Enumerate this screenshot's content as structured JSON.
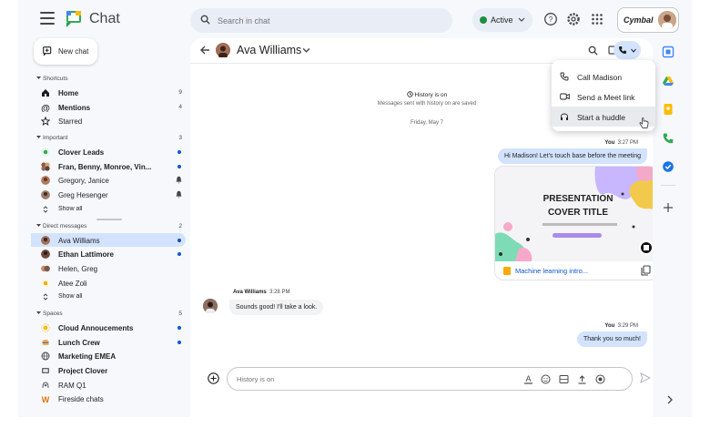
{
  "app": {
    "title": "Chat"
  },
  "search": {
    "placeholder": "Search in chat"
  },
  "status": {
    "label": "Active",
    "color": "#1e8e3e"
  },
  "account": {
    "org": "Cymbal"
  },
  "new_chat": {
    "label": "New chat"
  },
  "nav": {
    "shortcuts": {
      "title": "Shortcuts",
      "items": [
        {
          "label": "Home",
          "count": "9",
          "icon": "home-icon"
        },
        {
          "label": "Mentions",
          "count": "4",
          "icon": "at-icon"
        },
        {
          "label": "Starred",
          "icon": "star-icon"
        }
      ]
    },
    "important": {
      "title": "Important",
      "count": "3",
      "items": [
        {
          "label": "Clover Leads"
        },
        {
          "label": "Fran, Benny, Monroe, Vin..."
        },
        {
          "label": "Gregory, Janice"
        },
        {
          "label": "Greg Hesenger"
        },
        {
          "label": "Show all"
        }
      ]
    },
    "direct": {
      "title": "Direct messages",
      "count": "2",
      "items": [
        {
          "label": "Ava Williams"
        },
        {
          "label": "Ethan Lattimore"
        },
        {
          "label": "Helen, Greg"
        },
        {
          "label": "Atee Zoli"
        },
        {
          "label": "Show all"
        }
      ]
    },
    "spaces": {
      "title": "Spaces",
      "count": "5",
      "items": [
        {
          "label": "Cloud Annoucements"
        },
        {
          "label": "Lunch Crew"
        },
        {
          "label": "Marketing EMEA"
        },
        {
          "label": "Project Clover"
        },
        {
          "label": "RAM Q1"
        },
        {
          "label": "Fireside chats"
        }
      ]
    }
  },
  "conversation": {
    "name": "Ava Williams",
    "history_title": "History is on",
    "history_sub": "Messages sent with history on are saved",
    "date": "Friday, May 7",
    "messages": [
      {
        "sender": "You",
        "time": "3:27 PM",
        "text": "Hi Madison! Let's touch base before the meeting"
      },
      {
        "sender": "Ava Williams",
        "time": "3:28 PM",
        "text": "Sounds good! I'll take a look."
      },
      {
        "sender": "You",
        "time": "3:29 PM",
        "text": "Thank you so much!"
      }
    ],
    "attachment": {
      "slide_title_1": "PRESENTATION",
      "slide_title_2": "COVER TITLE",
      "file_name": "Machine learning intro..."
    },
    "composer_placeholder": "History is on"
  },
  "call_menu": {
    "items": [
      {
        "label": "Call Madison",
        "icon": "phone-icon"
      },
      {
        "label": "Send a Meet link",
        "icon": "video-icon"
      },
      {
        "label": "Start a huddle",
        "icon": "headphones-icon"
      }
    ]
  },
  "colors": {
    "accent": "#0b57d0",
    "selected": "#d3e3fd",
    "background": "#f6f8fc"
  }
}
